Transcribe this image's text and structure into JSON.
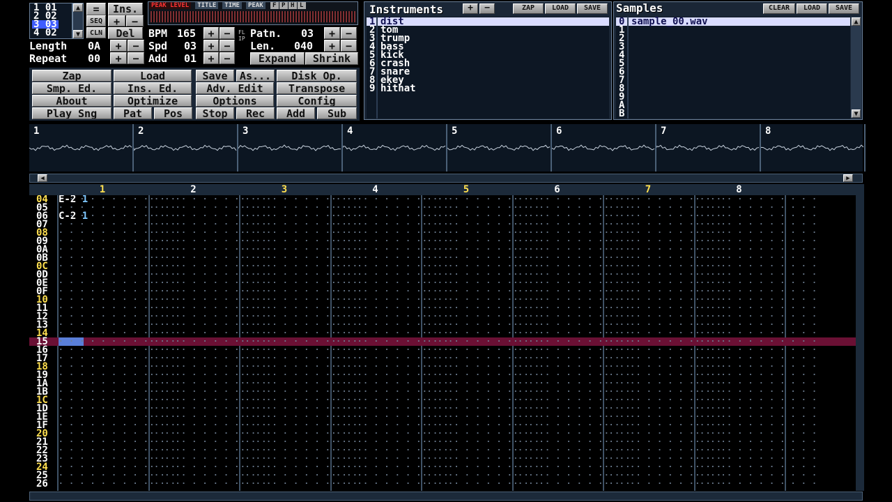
{
  "orders": {
    "rows": [
      {
        "pos": "1",
        "pat": "01"
      },
      {
        "pos": "2",
        "pat": "02"
      },
      {
        "pos": "3",
        "pat": "03"
      },
      {
        "pos": "4",
        "pat": "02"
      }
    ]
  },
  "pos_buttons": {
    "eq": "=",
    "ins": "Ins.",
    "seq": "SEQ",
    "plus": "+",
    "minus": "−",
    "cln": "CLN",
    "del": "Del"
  },
  "fields": {
    "length_label": "Length",
    "length_val": "0A",
    "repeat_label": "Repeat",
    "repeat_val": "00",
    "bpm_label": "BPM",
    "bpm_val": "165",
    "spd_label": "Spd",
    "spd_val": "03",
    "add_label": "Add",
    "add_val": "01",
    "patn_label": "Patn.",
    "patn_val": "03",
    "len_label": "Len.",
    "len_val": "040",
    "flip": "FLIP"
  },
  "meter": {
    "tabs": [
      "PEAK LEVEL",
      "TITLE",
      "TIME",
      "PEAK"
    ],
    "letters": [
      "F",
      "P",
      "H",
      "L"
    ]
  },
  "expand": "Expand",
  "shrink": "Shrink",
  "menu": [
    [
      "Zap",
      "Load",
      "Save",
      "As...",
      "Disk Op."
    ],
    [
      "Smp. Ed.",
      "Ins. Ed.",
      "Adv. Edit",
      "Transpose"
    ],
    [
      "About",
      "Optimize",
      "Options",
      "Config"
    ],
    [
      "Play Sng",
      "Pat",
      "Pos",
      "Stop",
      "Rec",
      "Add",
      "Sub"
    ]
  ],
  "instruments": {
    "title": "Instruments",
    "plus": "+",
    "minus": "−",
    "zap": "ZAP",
    "load": "LOAD",
    "save": "SAVE",
    "items": [
      {
        "n": "1",
        "name": "dist"
      },
      {
        "n": "2",
        "name": "tom"
      },
      {
        "n": "3",
        "name": "trump"
      },
      {
        "n": "4",
        "name": "bass"
      },
      {
        "n": "5",
        "name": "kick"
      },
      {
        "n": "6",
        "name": "crash"
      },
      {
        "n": "7",
        "name": "snare"
      },
      {
        "n": "8",
        "name": "ekey"
      },
      {
        "n": "9",
        "name": "hithat"
      }
    ]
  },
  "samples": {
    "title": "Samples",
    "clear": "CLEAR",
    "load": "LOAD",
    "save": "SAVE",
    "items": [
      {
        "n": "0",
        "name": "sample_00.wav"
      },
      {
        "n": "1",
        "name": ""
      },
      {
        "n": "2",
        "name": ""
      },
      {
        "n": "3",
        "name": ""
      },
      {
        "n": "4",
        "name": ""
      },
      {
        "n": "5",
        "name": ""
      },
      {
        "n": "6",
        "name": ""
      },
      {
        "n": "7",
        "name": ""
      },
      {
        "n": "8",
        "name": ""
      },
      {
        "n": "9",
        "name": ""
      },
      {
        "n": "A",
        "name": ""
      },
      {
        "n": "B",
        "name": ""
      }
    ]
  },
  "scopes": [
    "1",
    "2",
    "3",
    "4",
    "5",
    "6",
    "7",
    "8"
  ],
  "channels": [
    "1",
    "2",
    "3",
    "4",
    "5",
    "6",
    "7",
    "8"
  ],
  "pattern": {
    "rows": [
      "04",
      "05",
      "06",
      "07",
      "08",
      "09",
      "0A",
      "0B",
      "0C",
      "0D",
      "0E",
      "0F",
      "10",
      "11",
      "12",
      "13",
      "14",
      "15",
      "16",
      "17",
      "18",
      "19",
      "1A",
      "1B",
      "1C",
      "1D",
      "1E",
      "1F",
      "20",
      "21",
      "22",
      "23",
      "24",
      "25",
      "26"
    ],
    "cells": [
      [
        "E-2 1",
        "",
        "",
        "",
        "",
        "",
        "",
        "",
        ""
      ],
      [
        "",
        "",
        "",
        "",
        "",
        "",
        "",
        "",
        ""
      ],
      [
        "C-2 1",
        "",
        "",
        "",
        "",
        "",
        "",
        "",
        ""
      ]
    ]
  },
  "colors": {
    "bg": "#000000",
    "panel": "#1a2636",
    "highlight_row": "#6a1034",
    "note": "#ffffff",
    "instrument": "#7fc8ff",
    "volume": "#8cff6a",
    "row_number_highlight": "#ffe050"
  }
}
